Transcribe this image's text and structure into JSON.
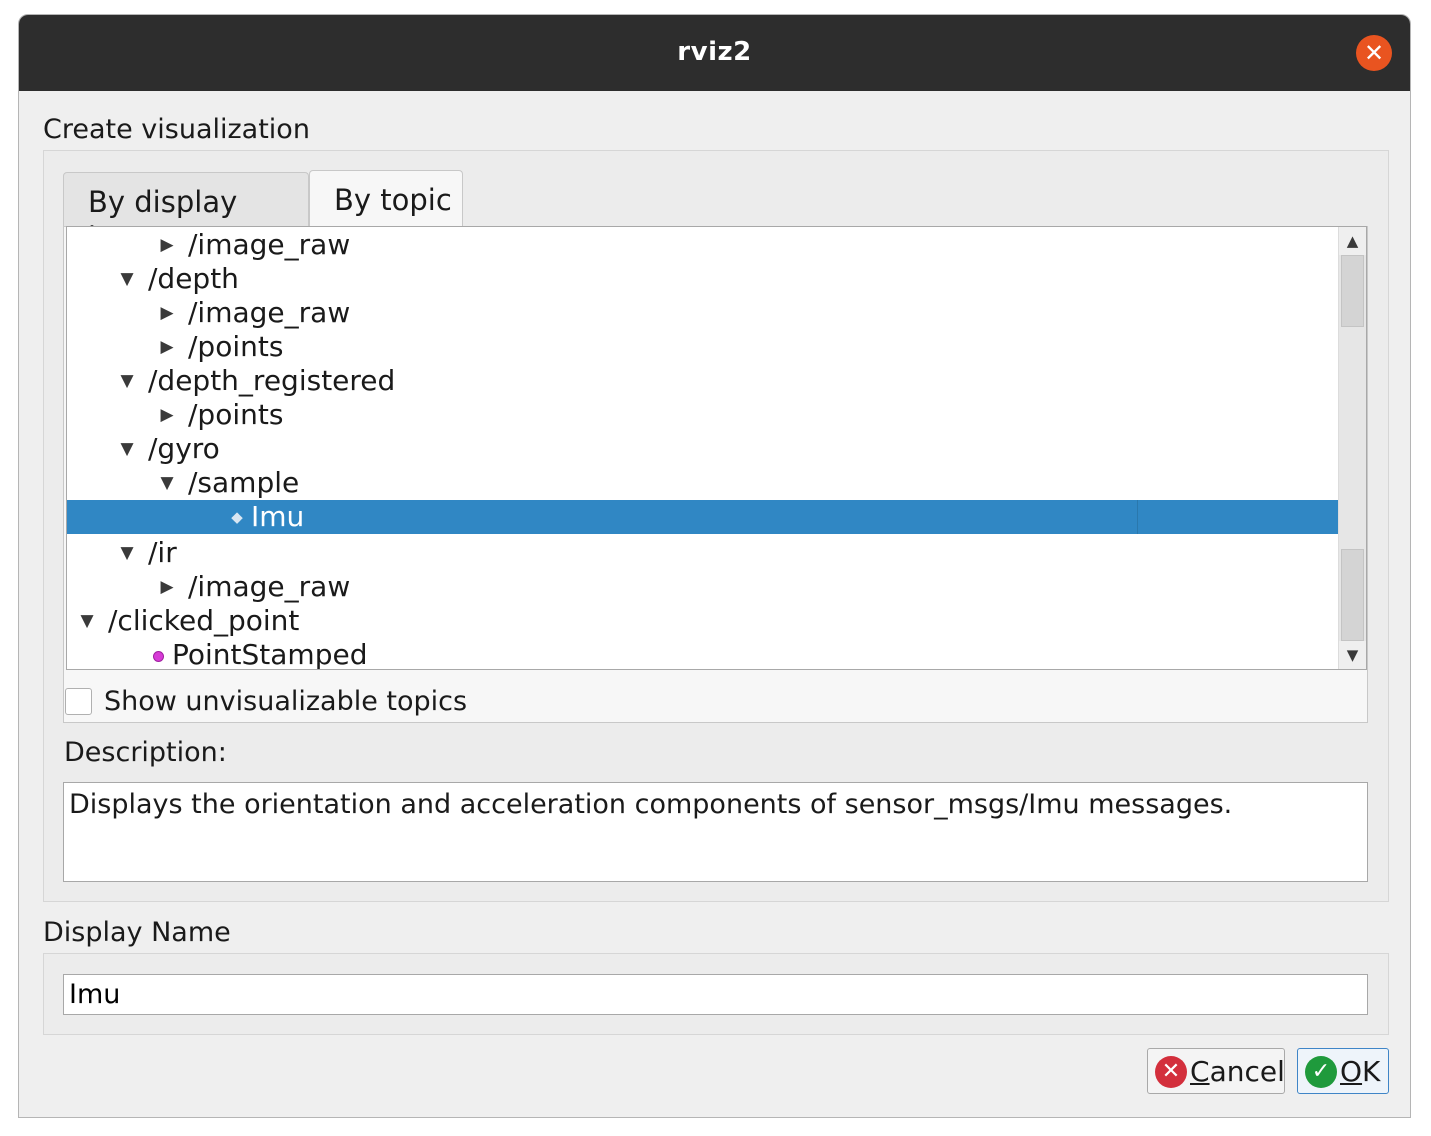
{
  "window": {
    "title": "rviz2"
  },
  "create_label": "Create visualization",
  "tabs": [
    {
      "label": "By display type",
      "active": false
    },
    {
      "label": "By topic",
      "active": true
    }
  ],
  "tree": {
    "rows": [
      {
        "label": "/image_raw",
        "arrow": "collapsed"
      },
      {
        "label": "/depth",
        "arrow": "expanded"
      },
      {
        "label": "/image_raw",
        "arrow": "collapsed"
      },
      {
        "label": "/points",
        "arrow": "collapsed"
      },
      {
        "label": "/depth_registered",
        "arrow": "expanded"
      },
      {
        "label": "/points",
        "arrow": "collapsed"
      },
      {
        "label": "/gyro",
        "arrow": "expanded"
      },
      {
        "label": "/sample",
        "arrow": "expanded"
      },
      {
        "label": "Imu",
        "arrow": "none",
        "icon": "imu-diamond-icon",
        "selected": true
      },
      {
        "label": "/ir",
        "arrow": "expanded"
      },
      {
        "label": "/image_raw",
        "arrow": "collapsed"
      },
      {
        "label": "/clicked_point",
        "arrow": "expanded"
      },
      {
        "label": "PointStamped",
        "arrow": "none",
        "icon": "point-dot-icon",
        "icon_color": "#d63bd6"
      }
    ]
  },
  "checkbox": {
    "label": "Show unvisualizable topics",
    "checked": false
  },
  "description": {
    "label": "Description:",
    "text": "Displays the orientation and acceleration components of sensor_msgs/Imu messages."
  },
  "display_name": {
    "label": "Display Name",
    "value": "Imu"
  },
  "buttons": {
    "cancel": {
      "label": "Cancel",
      "mnemonic": "C",
      "rest": "ancel"
    },
    "ok": {
      "label": "OK",
      "mnemonic": "O",
      "rest": "K"
    }
  },
  "colors": {
    "selection": "#3087c4",
    "close": "#e95420",
    "cancel_icon": "#d32f3c",
    "ok_icon": "#1f9a3c"
  }
}
